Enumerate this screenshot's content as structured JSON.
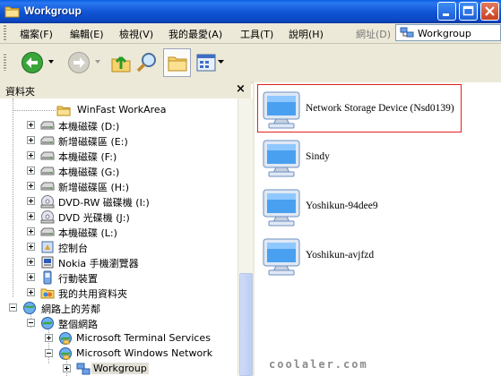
{
  "window": {
    "title": "Workgroup"
  },
  "menu": {
    "items": [
      "檔案(F)",
      "編輯(E)",
      "檢視(V)",
      "我的最愛(A)",
      "工具(T)",
      "說明(H)"
    ],
    "address_label": "網址(D)",
    "address_value": "Workgroup"
  },
  "folders_pane": {
    "title": "資料夾",
    "close_glyph": "×",
    "tree": [
      {
        "label": "WinFast WorkArea",
        "icon": "folder-icon"
      },
      {
        "label": "本機磁碟 (D:)",
        "icon": "drive-icon"
      },
      {
        "label": "新增磁碟區 (E:)",
        "icon": "drive-icon"
      },
      {
        "label": "本機磁碟 (F:)",
        "icon": "drive-icon"
      },
      {
        "label": "本機磁碟 (G:)",
        "icon": "drive-icon"
      },
      {
        "label": "新增磁碟區 (H:)",
        "icon": "drive-icon"
      },
      {
        "label": "DVD-RW 磁碟機 (I:)",
        "icon": "dvd-drive-icon"
      },
      {
        "label": "DVD 光碟機 (J:)",
        "icon": "dvd-drive-icon"
      },
      {
        "label": "本機磁碟 (L:)",
        "icon": "drive-icon"
      },
      {
        "label": "控制台",
        "icon": "control-panel-icon"
      },
      {
        "label": "Nokia 手機瀏覽器",
        "icon": "phone-browser-icon"
      },
      {
        "label": "行動裝置",
        "icon": "mobile-device-icon"
      },
      {
        "label": "我的共用資料夾",
        "icon": "shared-folder-icon"
      },
      {
        "label": "網路上的芳鄰",
        "icon": "network-places-icon"
      },
      {
        "label": "整個網路",
        "icon": "entire-network-icon"
      },
      {
        "label": "Microsoft Terminal Services",
        "icon": "network-provider-icon"
      },
      {
        "label": "Microsoft Windows Network",
        "icon": "network-provider-icon"
      },
      {
        "label": "Workgroup",
        "icon": "workgroup-icon"
      }
    ]
  },
  "content": {
    "items": [
      {
        "label": "Network Storage Device (Nsd0139)",
        "icon": "computer-icon",
        "selected": true
      },
      {
        "label": "Sindy",
        "icon": "computer-icon"
      },
      {
        "label": "Yoshikun-94dee9",
        "icon": "computer-icon"
      },
      {
        "label": "Yoshikun-avjfzd",
        "icon": "computer-icon"
      }
    ],
    "selection_color": "#e22020"
  },
  "watermark": "coolaler.com",
  "colors": {
    "titlebar": "#0a47c2",
    "chrome": "#ece9d8"
  }
}
